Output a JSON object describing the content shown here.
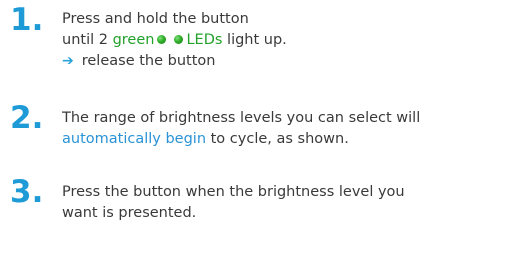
{
  "steps": [
    {
      "number": "1",
      "line1": "Press and hold the button",
      "line2_prefix": "until 2 ",
      "line2_green": "green",
      "line2_leds": "LEDs",
      "line2_suffix": " light up.",
      "line3_arrow": "➔",
      "line3_text": "release the button",
      "led_color": "#2fae2a"
    },
    {
      "number": "2",
      "line1": "The range of brightness levels you can select will",
      "line2_blue": "automatically begin",
      "line2_suffix": " to cycle, as shown."
    },
    {
      "number": "3",
      "line1": "Press the button when the brightness level you",
      "line2": "want is presented."
    }
  ],
  "colors": {
    "number_blue": "#1e9bd7",
    "link_blue": "#2a93d5",
    "green": "#23a12b",
    "text": "#3a3a3a"
  }
}
